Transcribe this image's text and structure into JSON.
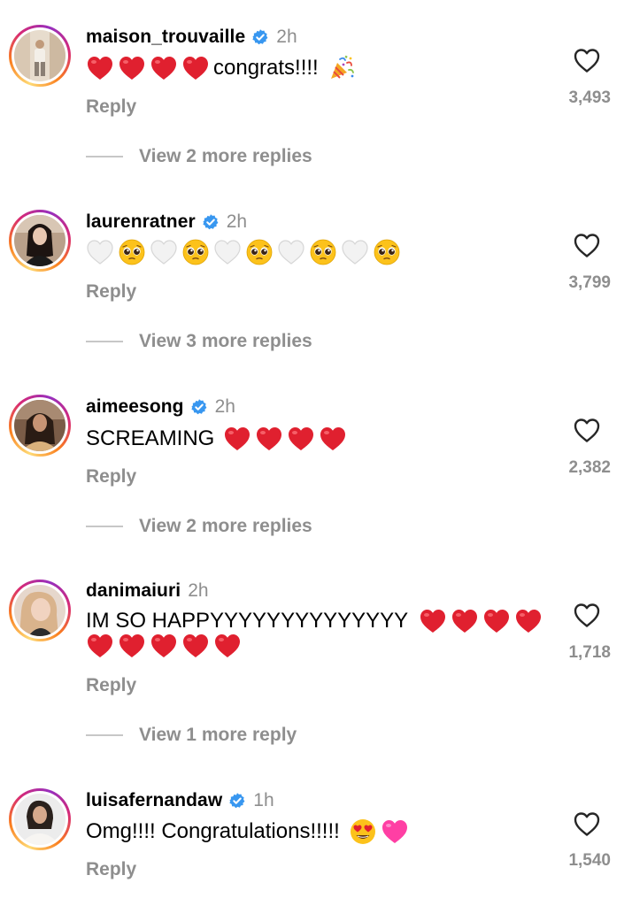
{
  "comments": [
    {
      "username": "maison_trouvaille",
      "verified": true,
      "time": "2h",
      "text": "congrats!!!!",
      "reply": "Reply",
      "likes": "3,493",
      "view_replies": "View 2 more replies"
    },
    {
      "username": "laurenratner",
      "verified": true,
      "time": "2h",
      "reply": "Reply",
      "likes": "3,799",
      "view_replies": "View 3 more replies"
    },
    {
      "username": "aimeesong",
      "verified": true,
      "time": "2h",
      "text": "SCREAMING",
      "reply": "Reply",
      "likes": "2,382",
      "view_replies": "View 2 more replies"
    },
    {
      "username": "danimaiuri",
      "verified": false,
      "time": "2h",
      "text": "IM SO HAPPYYYYYYYYYYYYYY",
      "reply": "Reply",
      "likes": "1,718",
      "view_replies": "View 1 more reply"
    },
    {
      "username": "luisafernandaw",
      "verified": true,
      "time": "1h",
      "text": "Omg!!!! Congratulations!!!!!",
      "reply": "Reply",
      "likes": "1,540"
    }
  ],
  "colors": {
    "verified_blue": "#3897f0",
    "muted_text": "#8e8e8e",
    "heart_red": "#e0202f",
    "heart_pink": "#ff3fa4"
  },
  "icons": {
    "verified": "verified-badge-icon",
    "like": "heart-outline-icon",
    "emoji_red_heart": "red-heart-emoji",
    "emoji_white_heart": "white-heart-emoji",
    "emoji_pleading": "pleading-face-emoji",
    "emoji_party": "party-popper-emoji",
    "emoji_heart_eyes": "heart-eyes-emoji",
    "emoji_pink_heart": "pink-heart-emoji"
  }
}
